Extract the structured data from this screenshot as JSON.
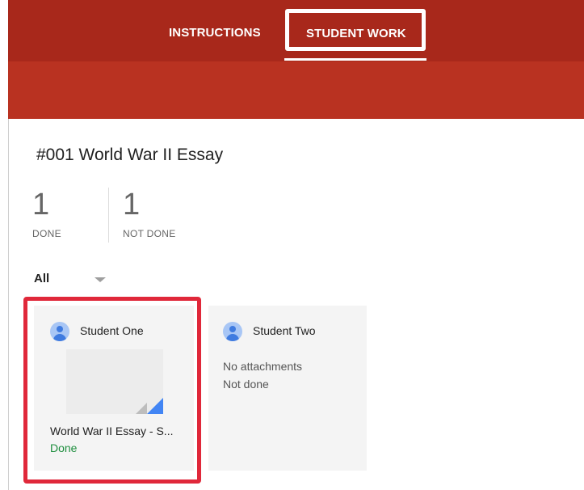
{
  "tabs": {
    "instructions": "INSTRUCTIONS",
    "student_work": "STUDENT WORK"
  },
  "assignment": {
    "title": "#001 World War II Essay"
  },
  "stats": {
    "done_count": "1",
    "done_label": "DONE",
    "not_done_count": "1",
    "not_done_label": "NOT DONE"
  },
  "filter": {
    "selected": "All"
  },
  "students": [
    {
      "name": "Student One",
      "attachment": "World War II Essay - S...",
      "status": "Done"
    },
    {
      "name": "Student Two",
      "attachments_text": "No attachments",
      "status": "Not done"
    }
  ],
  "colors": {
    "header": "#b93221",
    "tab_strip": "#a8281b",
    "highlight": "#e0283a",
    "done_green": "#1e8e3e",
    "file_fold": "#4285f4"
  }
}
